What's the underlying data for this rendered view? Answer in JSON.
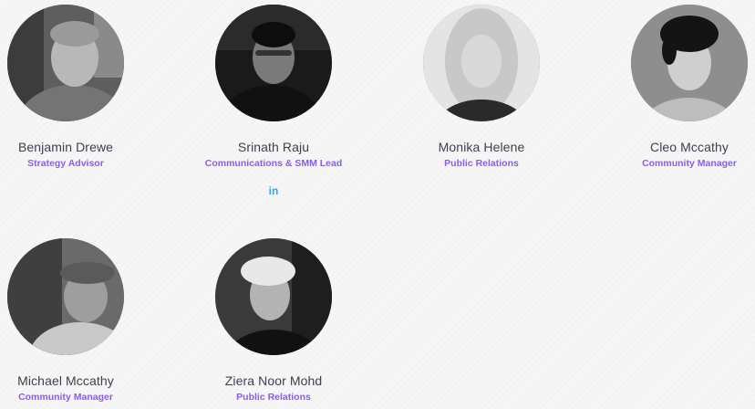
{
  "team": [
    {
      "name": "Benjamin Drewe",
      "role": "Strategy Advisor"
    },
    {
      "name": "Srinath Raju",
      "role": "Communications & SMM Lead",
      "social_icon": "linkedin-icon",
      "social_label": "in"
    },
    {
      "name": "Monika Helene",
      "role": "Public Relations"
    },
    {
      "name": "Cleo Mccathy",
      "role": "Community Manager"
    },
    {
      "name": "Michael Mccathy",
      "role": "Community Manager"
    },
    {
      "name": "Ziera Noor Mohd",
      "role": "Public Relations"
    }
  ],
  "colors": {
    "name_text": "#3d4150",
    "role_text": "#8a5cf0",
    "linkedin": "#2aa8e8"
  }
}
